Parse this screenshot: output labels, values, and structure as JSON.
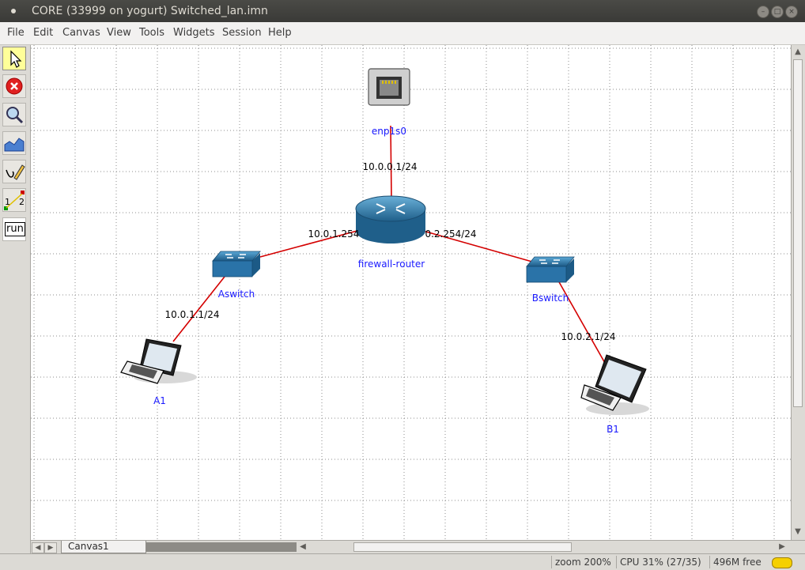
{
  "window": {
    "title": "CORE (33999 on yogurt) Switched_lan.imn"
  },
  "menu": {
    "items": [
      "File",
      "Edit",
      "Canvas",
      "View",
      "Tools",
      "Widgets",
      "Session",
      "Help"
    ]
  },
  "toolbar": {
    "tools": [
      {
        "name": "select-tool",
        "icon": "arrow-cursor-icon"
      },
      {
        "name": "stop-tool",
        "icon": "stop-icon"
      },
      {
        "name": "observer-tool",
        "icon": "magnifier-icon"
      },
      {
        "name": "plot-tool",
        "icon": "graph-icon"
      },
      {
        "name": "marker-tool",
        "icon": "pencil-icon"
      },
      {
        "name": "twonode-tool",
        "icon": "twonode-icon"
      },
      {
        "name": "run-tool",
        "icon": "run-icon"
      }
    ],
    "twonode_a": "1",
    "twonode_b": "2",
    "run_label": "run"
  },
  "nodes": {
    "enp1s0": "enp1s0",
    "router": "firewall-router",
    "aswitch": "Aswitch",
    "bswitch": "Bswitch",
    "a1": "A1",
    "b1": "B1"
  },
  "links": {
    "enp_router": "10.0.0.1/24",
    "router_aswitch": "10.0.1.254",
    "router_bswitch": "0.2.254/24",
    "aswitch_a1": "10.0.1.1/24",
    "bswitch_b1": "10.0.2.1/24"
  },
  "canvas_tab": "Canvas1",
  "status": {
    "zoom": "zoom 200%",
    "cpu": "CPU 31% (27/35)",
    "mem": "496M free"
  },
  "colors": {
    "link": "#d40000",
    "node_label": "#1a1aff",
    "ip_label": "#000000",
    "selected_tool": "#ffff99"
  }
}
